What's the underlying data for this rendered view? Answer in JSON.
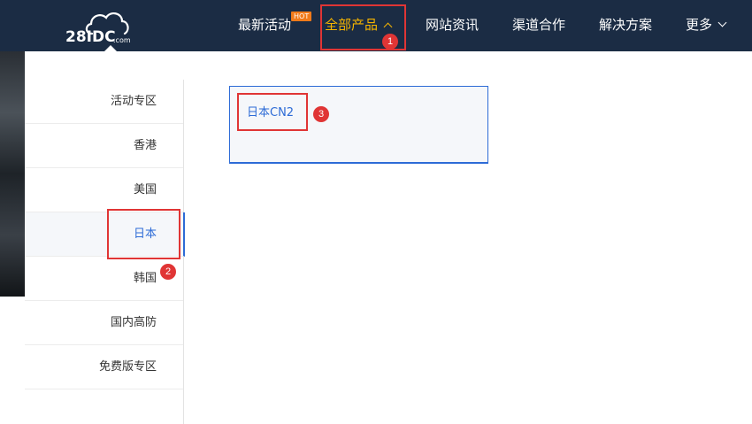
{
  "logo": {
    "text": "28IDC",
    "suffix": ".com"
  },
  "nav": {
    "items": [
      {
        "label": "最新活动",
        "badge": "HOT"
      },
      {
        "label": "全部产品",
        "active": true
      },
      {
        "label": "网站资讯"
      },
      {
        "label": "渠道合作"
      },
      {
        "label": "解决方案"
      },
      {
        "label": "更多"
      }
    ]
  },
  "sidebar": {
    "items": [
      {
        "label": "活动专区"
      },
      {
        "label": "香港"
      },
      {
        "label": "美国"
      },
      {
        "label": "日本",
        "active": true
      },
      {
        "label": "韩国"
      },
      {
        "label": "国内高防"
      },
      {
        "label": "免费版专区"
      }
    ]
  },
  "products": [
    {
      "label": "日本CN2"
    }
  ],
  "annotations": [
    "1",
    "2",
    "3"
  ],
  "colors": {
    "header_bg": "#1b2c44",
    "active_nav": "#f5b400",
    "accent_blue": "#2d6bd6",
    "hot_badge": "#f07a1a",
    "annotation_red": "#e03535"
  }
}
